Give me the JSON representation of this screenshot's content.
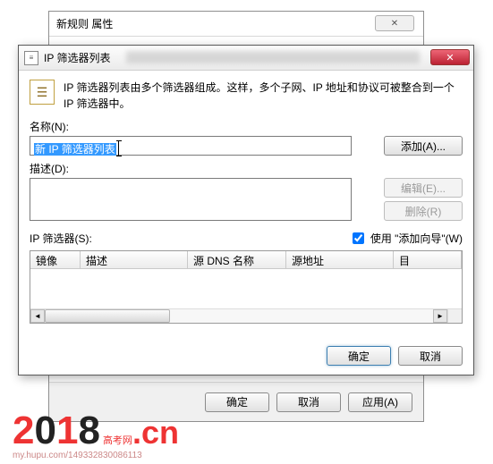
{
  "parent": {
    "title": "新规则 属性",
    "buttons": {
      "ok": "确定",
      "cancel": "取消",
      "apply": "应用(A)"
    }
  },
  "dialog": {
    "title": "IP 筛选器列表",
    "info_text": "IP 筛选器列表由多个筛选器组成。这样，多个子网、IP 地址和协议可被整合到一个 IP 筛选器中。",
    "name_label": "名称(N):",
    "name_value": "新 IP 筛选器列表",
    "desc_label": "描述(D):",
    "desc_value": "",
    "filters_label": "IP 筛选器(S):",
    "use_wizard_label": "使用 \"添加向导\"(W)",
    "use_wizard_checked": true,
    "btns": {
      "add": "添加(A)...",
      "edit": "编辑(E)...",
      "remove": "删除(R)"
    },
    "columns": {
      "mirror": "镜像",
      "desc": "描述",
      "src_dns": "源 DNS 名称",
      "src_addr": "源地址",
      "extra": "目"
    },
    "ok": "确定",
    "cancel": "取消"
  },
  "watermark": {
    "year": "2018",
    "suffix": ".cn",
    "tag": "高考网",
    "sub": "my.hupu.com/149332830086113"
  }
}
